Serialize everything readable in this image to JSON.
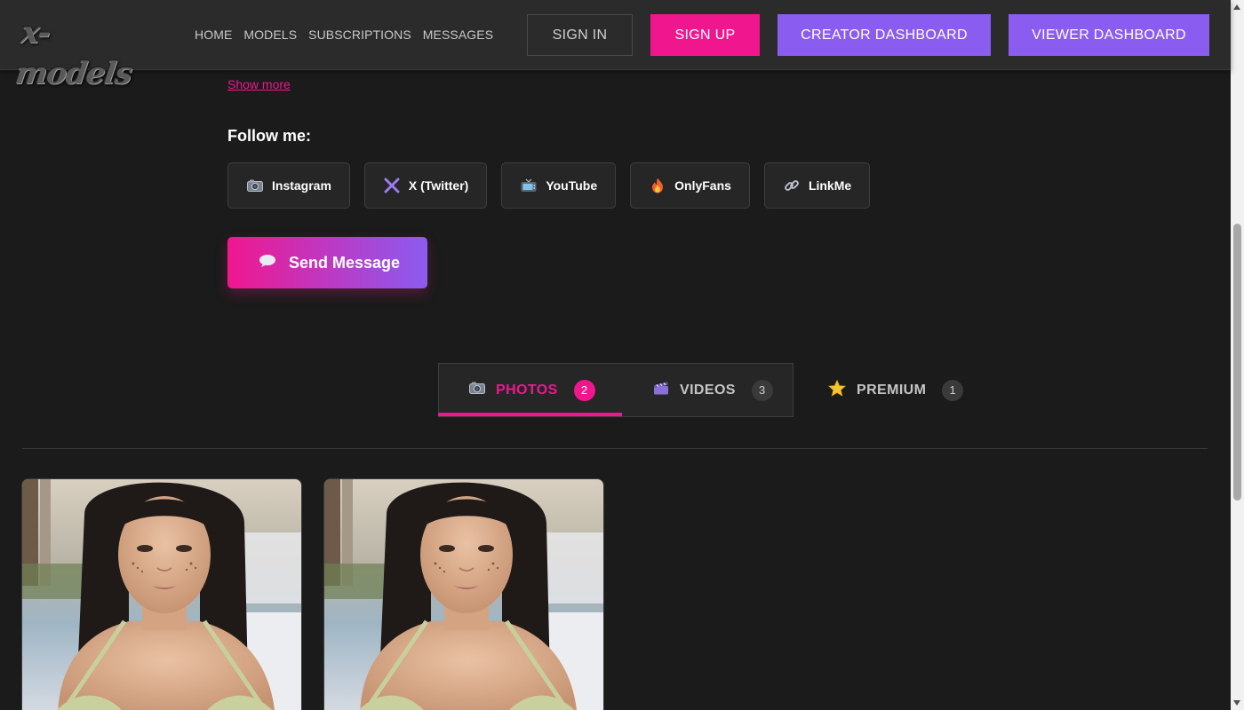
{
  "header": {
    "logo_text": "x-models",
    "nav": [
      "HOME",
      "MODELS",
      "SUBSCRIPTIONS",
      "MESSAGES"
    ],
    "sign_in": "SIGN IN",
    "sign_up": "SIGN UP",
    "creator_dashboard": "CREATOR DASHBOARD",
    "viewer_dashboard": "VIEWER DASHBOARD"
  },
  "profile": {
    "show_more": "Show more",
    "follow_title": "Follow me:",
    "socials": [
      {
        "label": "Instagram",
        "icon": "camera-icon"
      },
      {
        "label": "X (Twitter)",
        "icon": "x-icon"
      },
      {
        "label": "YouTube",
        "icon": "tv-icon"
      },
      {
        "label": "OnlyFans",
        "icon": "fire-icon"
      },
      {
        "label": "LinkMe",
        "icon": "link-icon"
      }
    ],
    "send_message": "Send Message"
  },
  "tabs": [
    {
      "label": "PHOTOS",
      "count": "2",
      "icon": "camera-icon",
      "active": true
    },
    {
      "label": "VIDEOS",
      "count": "3",
      "icon": "clapper-icon",
      "active": false
    },
    {
      "label": "PREMIUM",
      "count": "1",
      "icon": "star-icon",
      "active": false
    }
  ],
  "colors": {
    "accent_pink": "#f0178e",
    "accent_purple": "#8b5cf0",
    "background": "#1b1b1b",
    "header_bg": "#2b2b2b"
  }
}
